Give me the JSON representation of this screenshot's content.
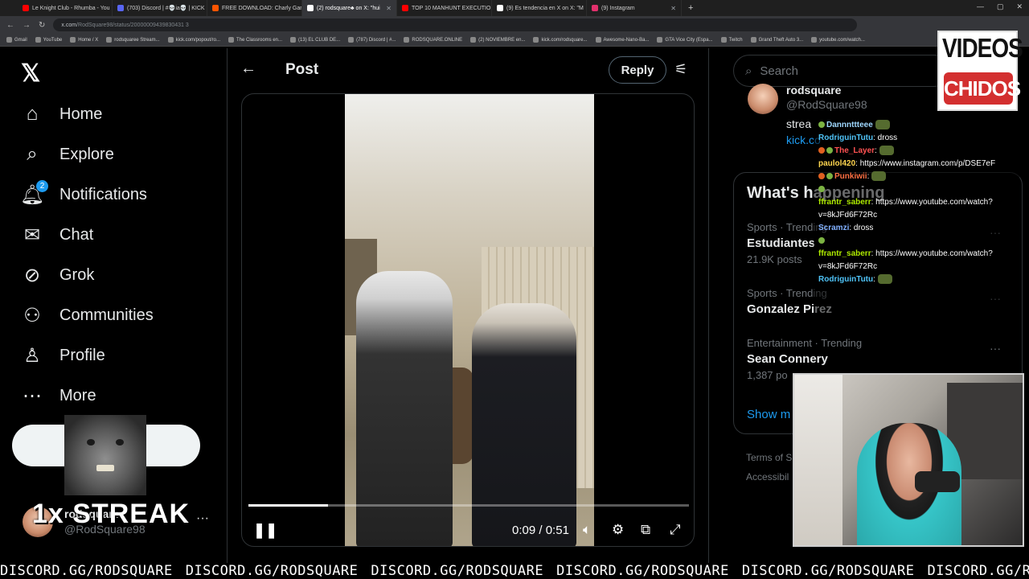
{
  "browser": {
    "tabs": [
      {
        "label": "Le Knight Club - Rhumba - You",
        "color": "#ff0000"
      },
      {
        "label": "(703) Discord | #💀ia💀 | KICK",
        "color": "#5865f2"
      },
      {
        "label": "FREE DOWNLOAD: Charly Garc",
        "color": "#ff5500"
      },
      {
        "label": "(2) rodsquare♣ on X: \"hui",
        "color": "#ffffff",
        "active": true
      },
      {
        "label": "TOP 10 MANHUNT EXECUTIO",
        "color": "#ff0000"
      },
      {
        "label": "(9) Es tendencia en X on X: \"M",
        "color": "#ffffff"
      },
      {
        "label": "(9) Instagram",
        "color": "#e1306c"
      }
    ],
    "url_host": "x.com",
    "url_path": "/RodSquare98/status/20000009439830431 3",
    "bookmarks": [
      "Gmail",
      "YouTube",
      "Home / X",
      "rodsquaree Stream...",
      "kick.com/popout/ro...",
      "The Classrooms en...",
      "(13) EL CLUB DE...",
      "(787) Discord | #...",
      "RODSQUARE.ONLINE",
      "(2) NOVIEMBRE en...",
      "kick.com/rodsquare...",
      "Awesome-Nano-Ba...",
      "GTA Vice City (Espa...",
      "Twitch",
      "Grand Theft Auto 3...",
      "youtube.com/watch..."
    ]
  },
  "sidebar": {
    "logo": "𝕏",
    "items": [
      {
        "label": "Home",
        "icon": "home-icon"
      },
      {
        "label": "Explore",
        "icon": "search-icon"
      },
      {
        "label": "Notifications",
        "icon": "bell-icon",
        "badge": "2"
      },
      {
        "label": "Chat",
        "icon": "mail-icon"
      },
      {
        "label": "Grok",
        "icon": "grok-icon"
      },
      {
        "label": "Communities",
        "icon": "communities-icon"
      },
      {
        "label": "Profile",
        "icon": "person-icon"
      },
      {
        "label": "More",
        "icon": "more-icon"
      }
    ],
    "profile": {
      "name": "rodsquare",
      "handle": "@RodSquare98",
      "more": "···"
    }
  },
  "overlay": {
    "streak": "1x STREAK",
    "ticker": "DISCORD.GG/RODSQUARE"
  },
  "post": {
    "back": "←",
    "title": "Post",
    "reply": "Reply",
    "video": {
      "current": "0:09",
      "duration": "0:51",
      "separator": " / ",
      "progress": 0.18
    }
  },
  "right": {
    "search_placeholder": "Search",
    "tweet": {
      "name": "rodsquare",
      "handle": "@RodSquare98",
      "text": "strea",
      "link": "kick.co"
    },
    "trends_title": "What's happening",
    "trends": [
      {
        "meta": "Sports · Trending",
        "name": "Estudiantes",
        "posts": "21.9K posts"
      },
      {
        "meta": "Sports · Trending",
        "name": "Gonzalez Pirez",
        "posts": ""
      },
      {
        "meta": "Entertainment · Trending",
        "name": "Sean Connery",
        "posts": "1,387 po"
      }
    ],
    "show_more": "Show m",
    "footer": [
      "Terms of S",
      "Accessibil"
    ]
  },
  "chat": [
    {
      "user": "Dannnttteee",
      "color": "#9fd8ff",
      "msg": "",
      "emote": true,
      "badge": "green"
    },
    {
      "user": "RodriguinTutu",
      "color": "#4fc3f7",
      "msg": ": dross",
      "emote": false,
      "badge": ""
    },
    {
      "user": "The_Layer",
      "color": "#ff5252",
      "msg": ":",
      "emote": true,
      "badge": "red"
    },
    {
      "user": "paulol420",
      "color": "#ffd54f",
      "msg": ": https://www.instagram.com/p/DSE7eF",
      "emote": false,
      "badge": ""
    },
    {
      "user": "Punkiwii",
      "color": "#ff7043",
      "msg": ":",
      "emote": true,
      "badge": "red"
    },
    {
      "user": "",
      "color": "#ffffff",
      "msg": "",
      "emote": false,
      "badge": "green"
    },
    {
      "user": "ffrantr_saberr",
      "color": "#aeea00",
      "msg": ": https://www.youtube.com/watch?",
      "emote": false,
      "badge": ""
    },
    {
      "user": "",
      "color": "#ffffff",
      "msg": "v=8kJFd6F72Rc",
      "emote": false,
      "badge": ""
    },
    {
      "user": "Scramzi",
      "color": "#82b1ff",
      "msg": ": dross",
      "emote": false,
      "badge": ""
    },
    {
      "user": "",
      "color": "#ffffff",
      "msg": "",
      "emote": false,
      "badge": "green"
    },
    {
      "user": "ffrantr_saberr",
      "color": "#aeea00",
      "msg": ": https://www.youtube.com/watch?",
      "emote": false,
      "badge": ""
    },
    {
      "user": "",
      "color": "#ffffff",
      "msg": "v=8kJFd6F72Rc",
      "emote": false,
      "badge": ""
    },
    {
      "user": "RodriguinTutu",
      "color": "#4fc3f7",
      "msg": ":",
      "emote": true,
      "badge": ""
    }
  ],
  "channel_logo": {
    "top": "VIDEOS",
    "bottom": "CHIDOS"
  }
}
